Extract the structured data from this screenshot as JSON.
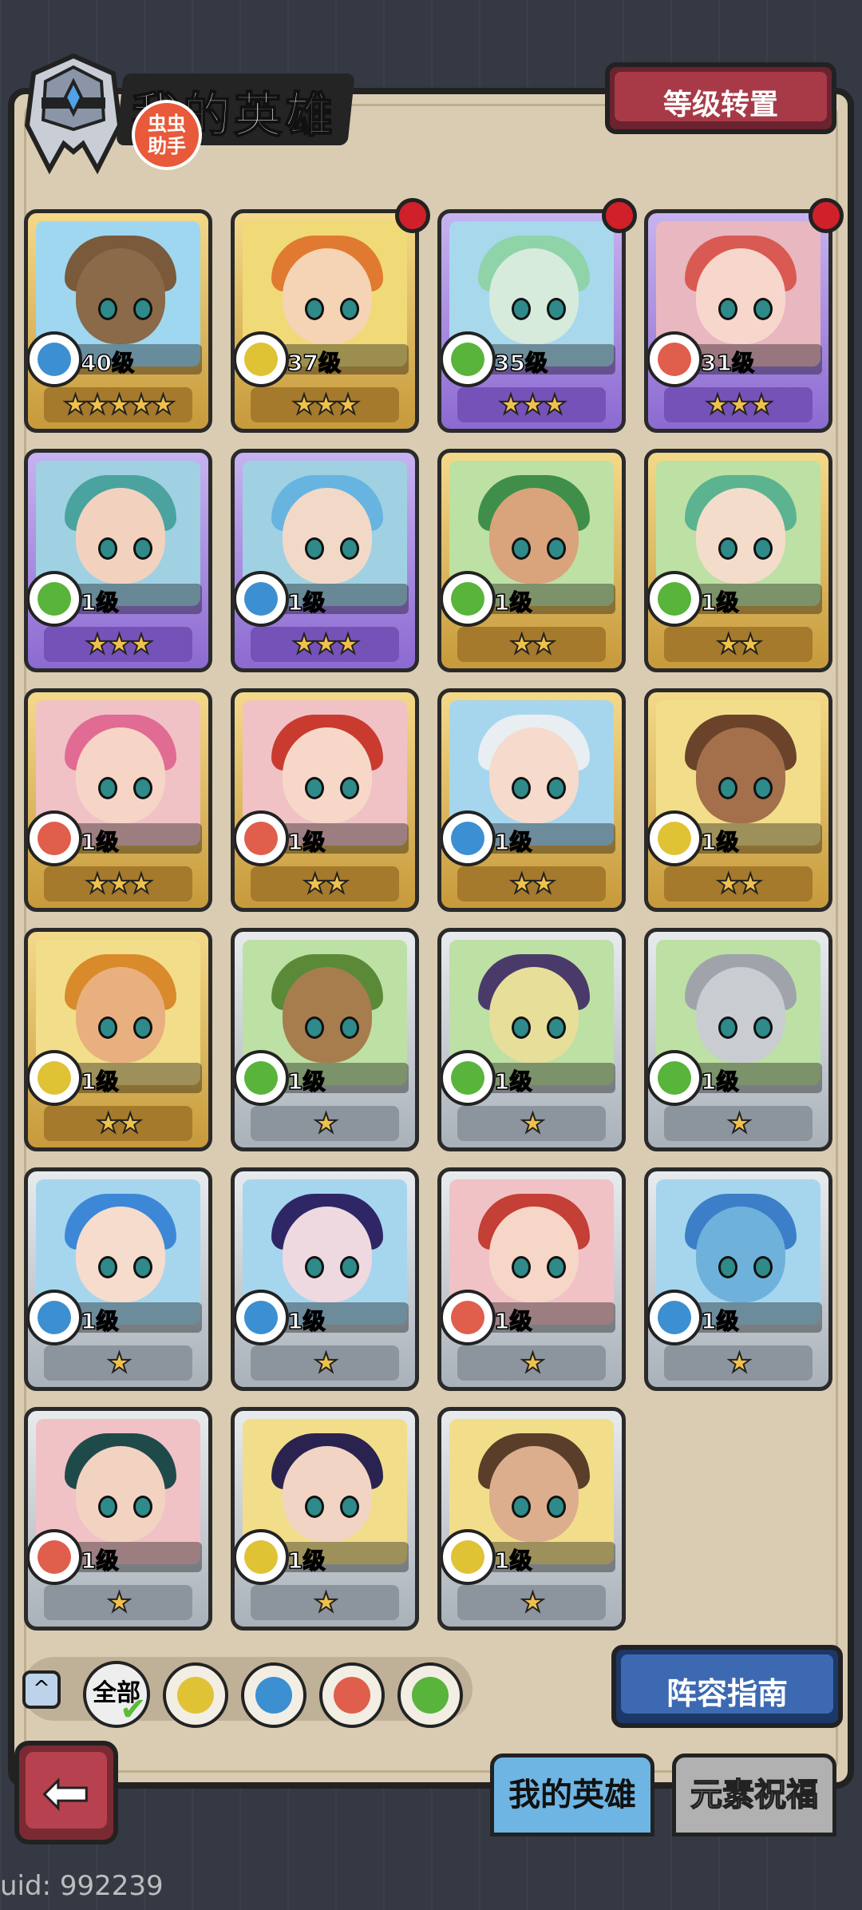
{
  "header": {
    "title": "我的英雄",
    "badge_line1": "虫虫",
    "badge_line2": "助手",
    "transfer_button": "等级转置"
  },
  "elements": {
    "water": "#3c8fd1",
    "earth": "#e0c235",
    "wind": "#58b43a",
    "fire": "#e05e4c"
  },
  "heroes": [
    {
      "level": "40级",
      "element": "water",
      "stars": "★★★★★",
      "frame": "gold",
      "bg": "#9fd7f0",
      "hair": "#7a5a3a",
      "skin": "#8a6a48",
      "dot": false
    },
    {
      "level": "37级",
      "element": "earth",
      "stars": "★★★",
      "frame": "gold",
      "bg": "#f0da78",
      "hair": "#e07a30",
      "skin": "#f5d3b5",
      "dot": true
    },
    {
      "level": "35级",
      "element": "wind",
      "stars": "★★★",
      "frame": "purple",
      "bg": "#a8d8ec",
      "hair": "#8fd3a8",
      "skin": "#d6ebdc",
      "dot": true
    },
    {
      "level": "31级",
      "element": "fire",
      "stars": "★★★",
      "frame": "purple",
      "bg": "#e8b7c0",
      "hair": "#d85a52",
      "skin": "#f7d7cb",
      "dot": true
    },
    {
      "level": "1级",
      "element": "wind",
      "stars": "★★★",
      "frame": "purple",
      "bg": "#9fd1e3",
      "hair": "#4aa39e",
      "skin": "#f2d2bf",
      "dot": false
    },
    {
      "level": "1级",
      "element": "water",
      "stars": "★★★",
      "frame": "purple",
      "bg": "#9fd1e3",
      "hair": "#67b4e0",
      "skin": "#f2d9c7",
      "dot": false
    },
    {
      "level": "1级",
      "element": "wind",
      "stars": "★★",
      "frame": "gold",
      "bg": "#bde0a4",
      "hair": "#3f8f4a",
      "skin": "#d9a37c",
      "dot": false
    },
    {
      "level": "1级",
      "element": "wind",
      "stars": "★★",
      "frame": "gold",
      "bg": "#bde0a4",
      "hair": "#5bb38f",
      "skin": "#f4dccb",
      "dot": false
    },
    {
      "level": "1级",
      "element": "fire",
      "stars": "★★★",
      "frame": "gold",
      "bg": "#f0c2c6",
      "hair": "#e06b93",
      "skin": "#f6d5c7",
      "dot": false
    },
    {
      "level": "1级",
      "element": "fire",
      "stars": "★★",
      "frame": "gold",
      "bg": "#f0c2c6",
      "hair": "#c93b2f",
      "skin": "#f7d8c8",
      "dot": false
    },
    {
      "level": "1级",
      "element": "water",
      "stars": "★★",
      "frame": "gold",
      "bg": "#a6d6ee",
      "hair": "#e9eef2",
      "skin": "#f6dacb",
      "dot": false
    },
    {
      "level": "1级",
      "element": "earth",
      "stars": "★★",
      "frame": "gold",
      "bg": "#f2de8a",
      "hair": "#6a432a",
      "skin": "#a3704b",
      "dot": false
    },
    {
      "level": "1级",
      "element": "earth",
      "stars": "★★",
      "frame": "gold",
      "bg": "#f2de8a",
      "hair": "#d98a2a",
      "skin": "#e9b07f",
      "dot": false
    },
    {
      "level": "1级",
      "element": "wind",
      "stars": "★",
      "frame": "silver",
      "bg": "#bde0a4",
      "hair": "#5a8a38",
      "skin": "#a77d4e",
      "dot": false
    },
    {
      "level": "1级",
      "element": "wind",
      "stars": "★",
      "frame": "silver",
      "bg": "#bde0a4",
      "hair": "#4a3a6a",
      "skin": "#e7de9a",
      "dot": false
    },
    {
      "level": "1级",
      "element": "wind",
      "stars": "★",
      "frame": "silver",
      "bg": "#bde0a4",
      "hair": "#a0a4aa",
      "skin": "#c9cdd2",
      "dot": false
    },
    {
      "level": "1级",
      "element": "water",
      "stars": "★",
      "frame": "silver",
      "bg": "#a6d6ee",
      "hair": "#3d88d6",
      "skin": "#f6dccd",
      "dot": false
    },
    {
      "level": "1级",
      "element": "water",
      "stars": "★",
      "frame": "silver",
      "bg": "#a6d6ee",
      "hair": "#2f2666",
      "skin": "#efd9e0",
      "dot": false
    },
    {
      "level": "1级",
      "element": "fire",
      "stars": "★",
      "frame": "silver",
      "bg": "#f0c2c6",
      "hair": "#c43f35",
      "skin": "#f6d6c6",
      "dot": false
    },
    {
      "level": "1级",
      "element": "water",
      "stars": "★",
      "frame": "silver",
      "bg": "#a6d6ee",
      "hair": "#3c7fc8",
      "skin": "#6eb2dc",
      "dot": false
    },
    {
      "level": "1级",
      "element": "fire",
      "stars": "★",
      "frame": "silver",
      "bg": "#f0c2c6",
      "hair": "#1f4a4a",
      "skin": "#f2d3c2",
      "dot": false
    },
    {
      "level": "1级",
      "element": "earth",
      "stars": "★",
      "frame": "silver",
      "bg": "#f2de8a",
      "hair": "#2a2350",
      "skin": "#f1d4c4",
      "dot": false
    },
    {
      "level": "1级",
      "element": "earth",
      "stars": "★",
      "frame": "silver",
      "bg": "#f2de8a",
      "hair": "#5a3e2a",
      "skin": "#dcae8d",
      "dot": false
    }
  ],
  "filter": {
    "toggle_icon": "^",
    "all_label": "全部",
    "check": "✔",
    "options": [
      "earth",
      "water",
      "fire",
      "wind"
    ]
  },
  "lineup_guide_button": "阵容指南",
  "tabs": {
    "my_heroes": "我的英雄",
    "element_blessing": "元素祝福"
  },
  "back_icon": "⬅",
  "uid": "uid: 992239"
}
